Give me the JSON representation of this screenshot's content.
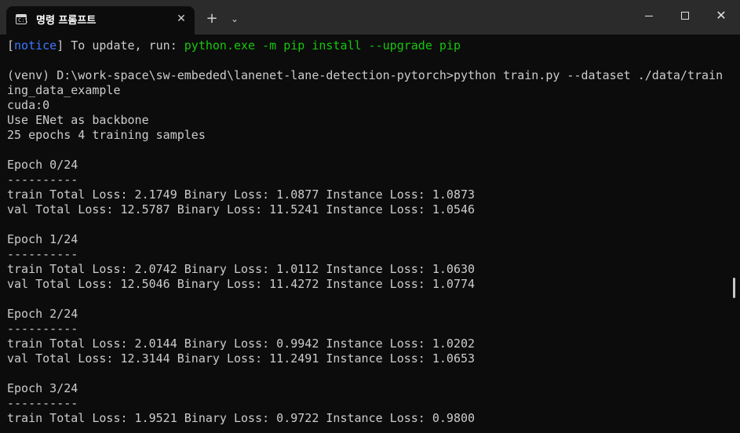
{
  "window": {
    "tab_title": "명령 프롬프트",
    "tab_icon_prompt": "C:\\",
    "tab_close": "✕",
    "new_tab": "+",
    "tab_dropdown": "⌄",
    "minimize_label": "",
    "maximize_label": "",
    "close_label": "✕"
  },
  "terminal": {
    "notice": {
      "open_bracket": "[",
      "tag": "notice",
      "close_bracket": "]",
      "text": " To update, run: ",
      "command": "python.exe -m pip install --upgrade pip"
    },
    "lines": [
      "",
      "(venv) D:\\work-space\\sw-embeded\\lanenet-lane-detection-pytorch>python train.py --dataset ./data/train",
      "ing_data_example",
      "cuda:0",
      "Use ENet as backbone",
      "25 epochs 4 training samples",
      "",
      "Epoch 0/24",
      "----------",
      "train Total Loss: 2.1749 Binary Loss: 1.0877 Instance Loss: 1.0873",
      "val Total Loss: 12.5787 Binary Loss: 11.5241 Instance Loss: 1.0546",
      "",
      "Epoch 1/24",
      "----------",
      "train Total Loss: 2.0742 Binary Loss: 1.0112 Instance Loss: 1.0630",
      "val Total Loss: 12.5046 Binary Loss: 11.4272 Instance Loss: 1.0774",
      "",
      "Epoch 2/24",
      "----------",
      "train Total Loss: 2.0144 Binary Loss: 0.9942 Instance Loss: 1.0202",
      "val Total Loss: 12.3144 Binary Loss: 11.2491 Instance Loss: 1.0653",
      "",
      "Epoch 3/24",
      "----------",
      "train Total Loss: 1.9521 Binary Loss: 0.9722 Instance Loss: 0.9800"
    ]
  },
  "colors": {
    "background": "#0c0c0c",
    "titlebar": "#2b2b2b",
    "text": "#cccccc",
    "notice_blue": "#3b78ff",
    "command_green": "#16c60c"
  }
}
